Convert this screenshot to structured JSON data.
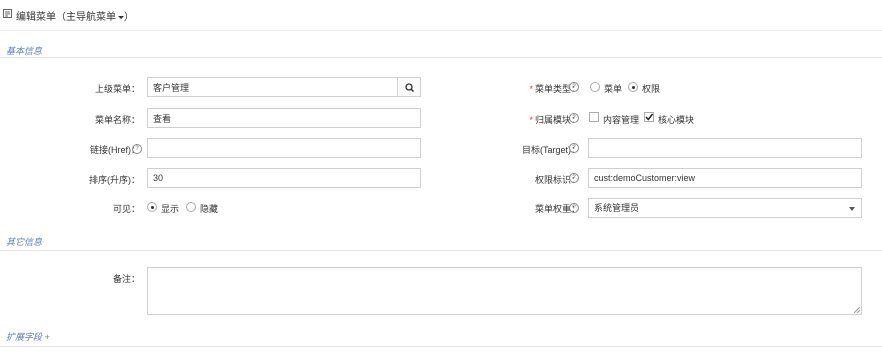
{
  "header": {
    "title": "编辑菜单（主导航菜单",
    "close": "）",
    "icon": "document-icon"
  },
  "sections": {
    "basic": "基本信息",
    "other": "其它信息",
    "ext": "扩展字段 +"
  },
  "form": {
    "parent_menu": {
      "label": "上级菜单：",
      "value": "客户管理"
    },
    "menu_name": {
      "label": "菜单名称：",
      "value": "查看"
    },
    "href": {
      "label": "链接(Href)：",
      "value": ""
    },
    "sort": {
      "label": "排序(升序)：",
      "value": "30"
    },
    "visible": {
      "label": "可见：",
      "options": [
        "显示",
        "隐藏"
      ],
      "selected": "显示"
    },
    "menu_type": {
      "label": "菜单类型：",
      "options": [
        "菜单",
        "权限"
      ],
      "selected": "权限"
    },
    "module": {
      "label": "归属模块：",
      "options": [
        "内容管理",
        "核心模块"
      ],
      "checked": [
        "核心模块"
      ]
    },
    "target": {
      "label": "目标(Target)：",
      "value": ""
    },
    "permission": {
      "label": "权限标识：",
      "value": "cust:demoCustomer:view"
    },
    "weight": {
      "label": "菜单权重：",
      "value": "系统管理员"
    },
    "remarks": {
      "label": "备注：",
      "value": ""
    }
  },
  "colors": {
    "section_title": "#5a7fb8",
    "required": "#e4393c",
    "border": "#cfcfcf"
  }
}
